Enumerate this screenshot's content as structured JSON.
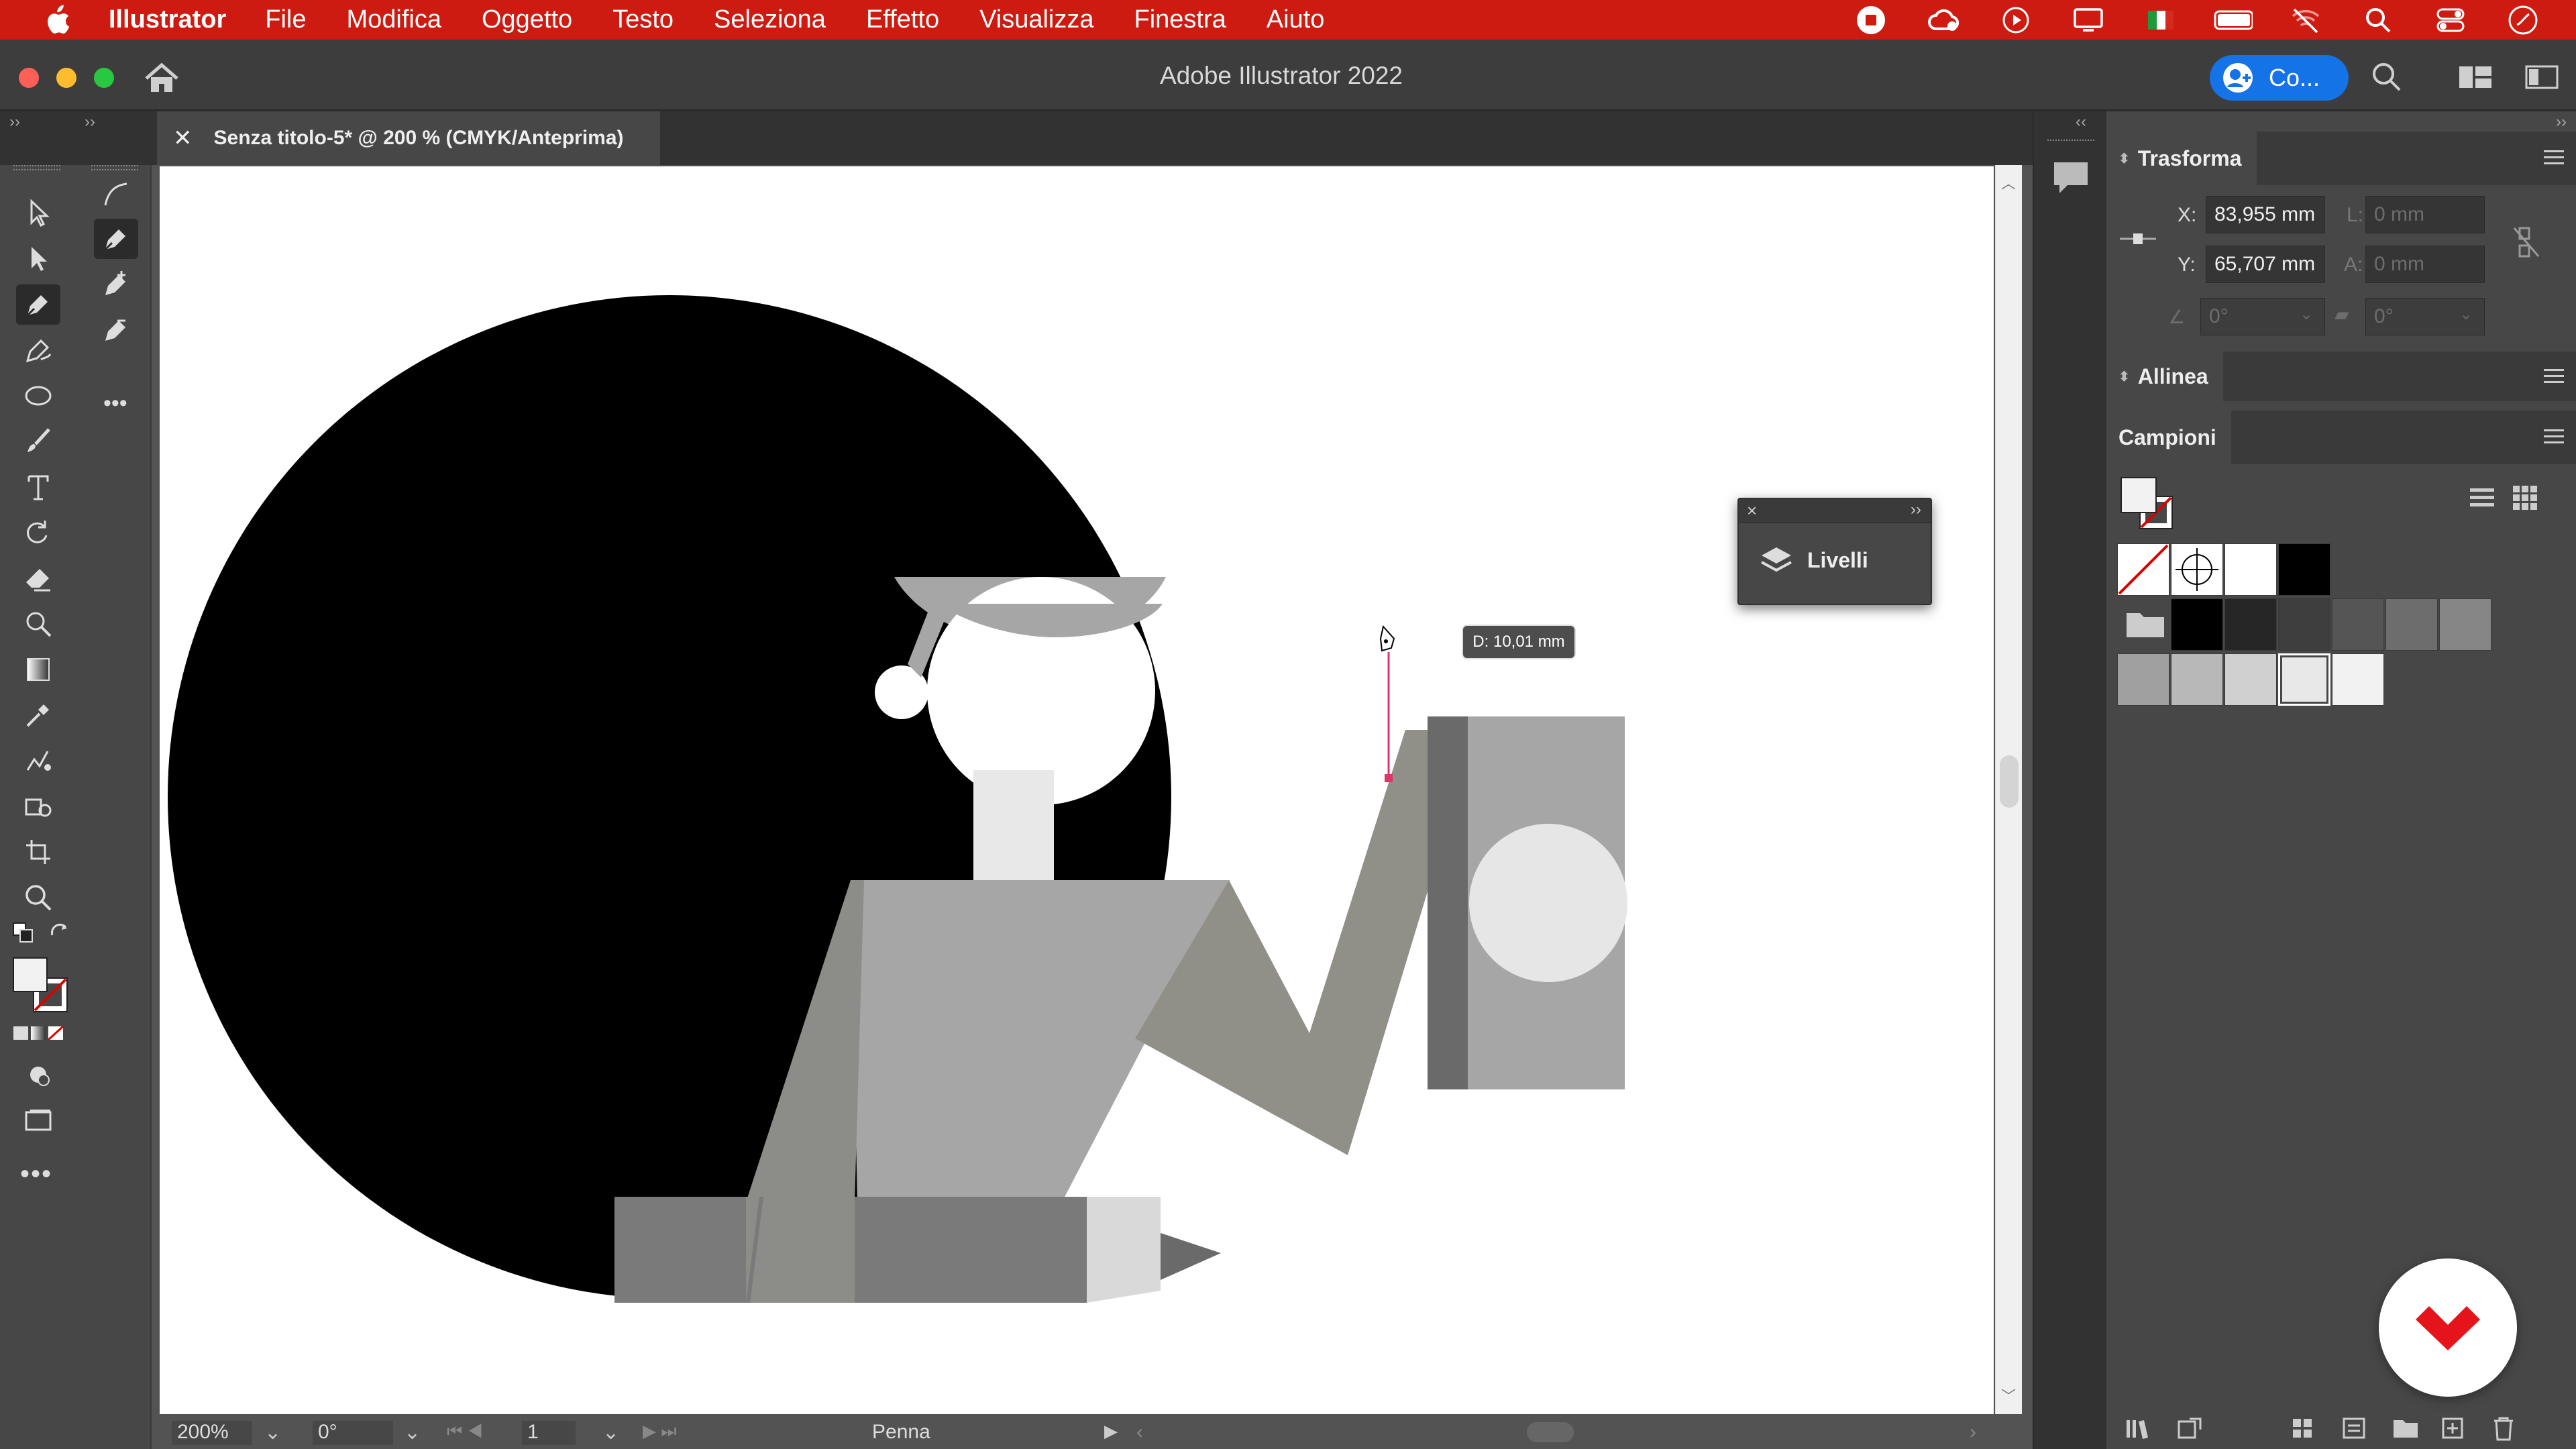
{
  "menubar": {
    "app_name": "Illustrator",
    "items": [
      "File",
      "Modifica",
      "Oggetto",
      "Testo",
      "Seleziona",
      "Effetto",
      "Visualizza",
      "Finestra",
      "Aiuto"
    ]
  },
  "window": {
    "title": "Adobe Illustrator 2022",
    "collab_button": "Co..."
  },
  "document_tab": {
    "label": "Senza titolo-5* @ 200 % (CMYK/Anteprima)"
  },
  "canvas": {
    "measure_tooltip": "D: 10,01 mm",
    "floating_panel": "Livelli"
  },
  "status_bar": {
    "zoom": "200%",
    "rotation": "0°",
    "artboard_number": "1",
    "current_tool": "Penna"
  },
  "panels": {
    "transform": {
      "title": "Trasforma",
      "x_label": "X:",
      "x_value": "83,955 mm",
      "y_label": "Y:",
      "y_value": "65,707 mm",
      "w_label": "L:",
      "w_value": "0 mm",
      "h_label": "A:",
      "h_value": "0 mm",
      "rotate_value": "0°",
      "shear_value": "0°"
    },
    "align": {
      "title": "Allinea"
    },
    "swatches": {
      "title": "Campioni"
    }
  },
  "colors": {
    "menubar": "#cd1b12",
    "accent": "#1473e6",
    "pen_path": "#e0356b"
  }
}
